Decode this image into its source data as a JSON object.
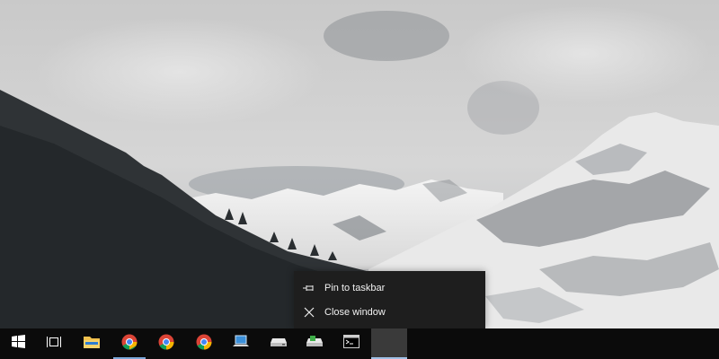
{
  "desktop": {
    "wallpaper": "snowy-mountains-and-forest"
  },
  "jumplist": {
    "items": [
      {
        "label": "Pin to taskbar",
        "icon": "pin-icon"
      },
      {
        "label": "Close window",
        "icon": "close-icon"
      }
    ]
  },
  "taskbar": {
    "buttons": [
      {
        "icon": "windows-start-icon"
      },
      {
        "icon": "task-view-icon"
      },
      {
        "icon": "file-explorer-icon"
      },
      {
        "icon": "chrome-icon",
        "running": true
      },
      {
        "icon": "chrome-icon"
      },
      {
        "icon": "chrome-icon"
      },
      {
        "icon": "laptop-app-icon"
      },
      {
        "icon": "drive-icon"
      },
      {
        "icon": "drive-green-icon"
      },
      {
        "icon": "command-prompt-icon"
      },
      {
        "icon": "blank-window-icon",
        "selected": true
      }
    ]
  },
  "colors": {
    "taskbar": "#0b0b0b",
    "menu": "#1e1e1e",
    "accent": "#7aa7d8"
  }
}
